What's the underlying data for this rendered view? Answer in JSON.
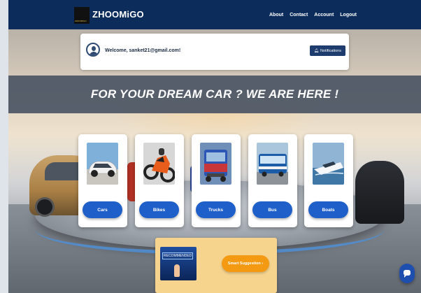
{
  "header": {
    "logo_text": "ZHOOMIGO",
    "brand": "ZHOOMiGO",
    "nav": [
      "About",
      "Contact",
      "Account",
      "Logout"
    ]
  },
  "welcome": {
    "text": "Welcome, sanket21@gmail.com!",
    "notifications_label": "Notifications"
  },
  "banner": {
    "text": "FOR YOUR DREAM CAR ? WE ARE HERE !"
  },
  "categories": [
    {
      "label": "Cars",
      "icon": "car-icon",
      "colors": [
        "#7fb0d9",
        "#f0f0f0"
      ]
    },
    {
      "label": "Bikes",
      "icon": "bike-icon",
      "colors": [
        "#d7d7d7",
        "#e85d1c"
      ]
    },
    {
      "label": "Trucks",
      "icon": "truck-icon",
      "colors": [
        "#2c56b5",
        "#c8363a"
      ]
    },
    {
      "label": "Bus",
      "icon": "bus-icon",
      "colors": [
        "#aac6dd",
        "#1d5da8"
      ]
    },
    {
      "label": "Boats",
      "icon": "boat-icon",
      "colors": [
        "#8fb4d4",
        "#f4f6f8"
      ]
    }
  ],
  "recommendation": {
    "image_label": "RECOMMENDED",
    "button_label": "Smart Suggestion ›"
  },
  "chat": {
    "icon": "chat-icon"
  },
  "colors": {
    "header": "#0c2c5c",
    "button_blue": "#1f5fc9",
    "suggestion_orange": "#f39a12",
    "recommend_bg": "#f6d48e"
  }
}
